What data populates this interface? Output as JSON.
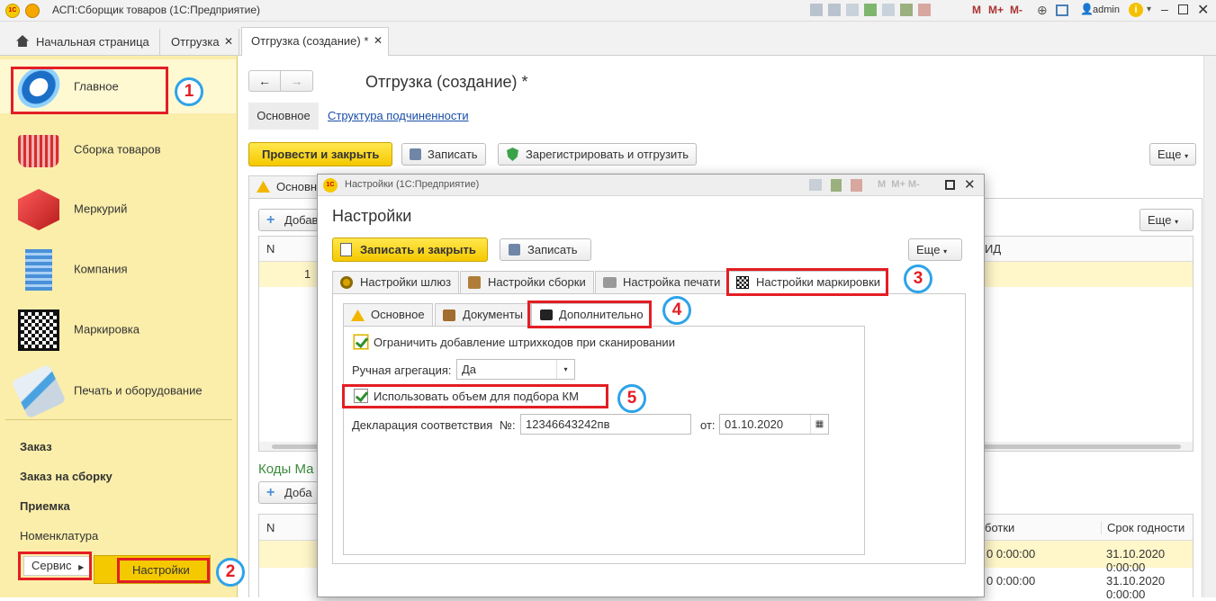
{
  "window": {
    "title": "АСП:Сборщик товаров  (1С:Предприятие)",
    "user": "admin",
    "mem_buttons": [
      "M",
      "M+",
      "M-"
    ]
  },
  "tabs": [
    {
      "label": "Начальная страница"
    },
    {
      "label": "Отгрузка"
    },
    {
      "label": "Отгрузка (создание) *"
    }
  ],
  "sidebar": {
    "items": [
      {
        "label": "Главное",
        "icon": "main-section-icon"
      },
      {
        "label": "Сборка товаров",
        "icon": "basket-icon"
      },
      {
        "label": "Меркурий",
        "icon": "cube-icon"
      },
      {
        "label": "Компания",
        "icon": "building-icon"
      },
      {
        "label": "Маркировка",
        "icon": "qr-code-icon"
      },
      {
        "label": "Печать и оборудование",
        "icon": "payment-terminal-icon"
      }
    ],
    "links": [
      "Заказ",
      "Заказ на сборку",
      "Приемка",
      "Номенклатура"
    ],
    "service_label": "Сервис",
    "submenu_label": "Настройки"
  },
  "doc": {
    "title": "Отгрузка (создание) *",
    "nav": [
      "Основное",
      "Структура подчиненности"
    ],
    "post_close": "Провести и закрыть",
    "write": "Записать",
    "register_ship": "Зарегистрировать и отгрузить",
    "more": "Еще",
    "section_tab": "Основн",
    "add": "Добав",
    "add2": "Доба",
    "grid_col_n": "N",
    "grid_col_id": "ИД",
    "row_num": "1",
    "codes_title": "Коды Ма",
    "grid2_cols": [
      "N",
      "ботки",
      "Срок годности"
    ],
    "grid2_rows": [
      [
        "0 0:00:00",
        "31.10.2020 0:00:00"
      ],
      [
        "0 0:00:00",
        "31.10.2020 0:00:00"
      ]
    ]
  },
  "dialog": {
    "window_title": "Настройки  (1С:Предприятие)",
    "heading": "Настройки",
    "write_close": "Записать и закрыть",
    "write": "Записать",
    "more": "Еще",
    "tabs": [
      "Настройки шлюз",
      "Настройки сборки",
      "Настройка печати",
      "Настройки маркировки"
    ],
    "subtabs": [
      "Основное",
      "Документы",
      "Дополнительно"
    ],
    "chk_limit": "Ограничить добавление штрихкодов при сканировании",
    "manual_agg_label": "Ручная агрегация:",
    "manual_agg_value": "Да",
    "chk_volume": "Использовать объем для подбора КМ",
    "decl_label": "Декларация соответствия",
    "num_label": "№:",
    "num_value": "12346643242пв",
    "date_label": "от:",
    "date_value": "01.10.2020"
  },
  "badges": [
    "1",
    "2",
    "3",
    "4",
    "5"
  ],
  "colors": {
    "accent_yellow": "#f5c900",
    "highlight_red": "#e31e24",
    "badge_blue": "#2ea3e8",
    "sidebar": "#fbeeaa"
  }
}
